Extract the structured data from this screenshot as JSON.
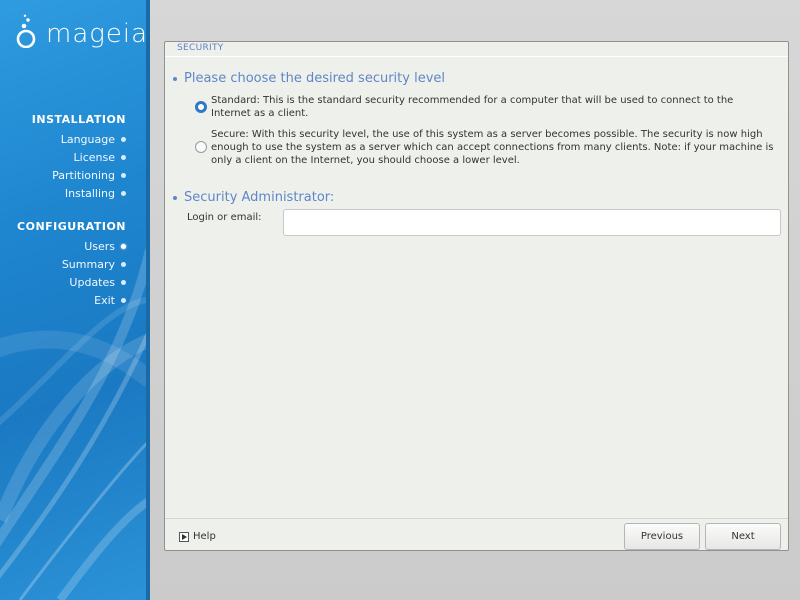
{
  "brand": {
    "logo_text": "mageia"
  },
  "sidebar": {
    "installation": {
      "heading": "INSTALLATION",
      "items": [
        {
          "label": "Language"
        },
        {
          "label": "License"
        },
        {
          "label": "Partitioning"
        },
        {
          "label": "Installing"
        }
      ]
    },
    "configuration": {
      "heading": "CONFIGURATION",
      "items": [
        {
          "label": "Users"
        },
        {
          "label": "Summary"
        },
        {
          "label": "Updates"
        },
        {
          "label": "Exit"
        }
      ]
    }
  },
  "panel": {
    "title": "SECURITY",
    "level_section": {
      "heading": "Please choose the desired security level",
      "options": [
        {
          "label": "Standard: This is the standard security recommended for a computer that will be used to connect to the Internet as a client.",
          "selected": true
        },
        {
          "label": "Secure: With this security level, the use of this system as a server becomes possible. The security is now high enough to use the system as a server which can accept connections from many clients. Note: if your machine is only a client on the Internet, you should choose a lower level.",
          "selected": false
        }
      ]
    },
    "admin_section": {
      "heading": "Security Administrator:",
      "login_label": "Login or email:",
      "login_value": ""
    }
  },
  "footer": {
    "help_label": "Help",
    "previous_label": "Previous",
    "next_label": "Next"
  },
  "colors": {
    "sidebar_blue": "#1e86cf",
    "heading_blue": "#5f86c8",
    "radio_selected": "#2f78c8",
    "panel_bg": "#eef0eb"
  }
}
